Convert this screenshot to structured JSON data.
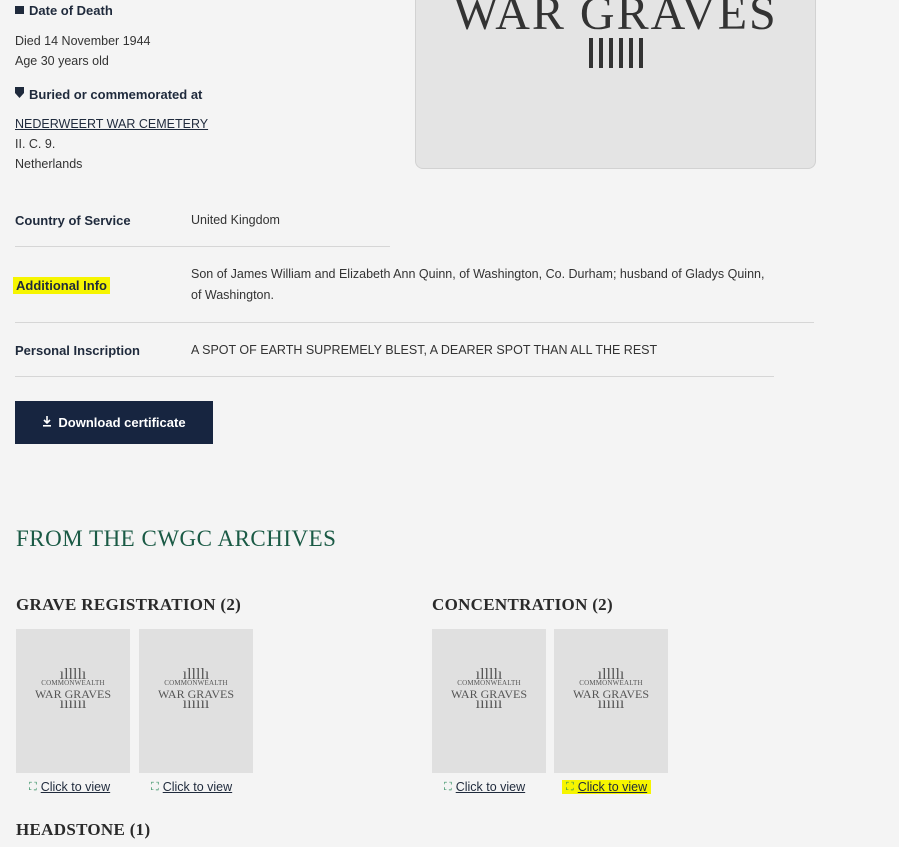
{
  "panel": {
    "title": "WAR GRAVES"
  },
  "death": {
    "heading": "Date of Death",
    "line1": "Died 14 November 1944",
    "line2": "Age 30 years old"
  },
  "burial": {
    "heading": "Buried or commemorated at",
    "cemetery": "NEDERWEERT WAR CEMETERY",
    "plot": "II. C. 9.",
    "country": "Netherlands"
  },
  "details": {
    "country_label": "Country of Service",
    "country_value": "United Kingdom",
    "info_label": "Additional Info",
    "info_line1": "Son of James William and Elizabeth Ann Quinn, of Washington, Co. Durham; husband of Gladys Quinn,",
    "info_line2": "of Washington.",
    "inscription_label": "Personal Inscription",
    "inscription_value": "A SPOT OF EARTH SUPREMELY BLEST, A DEARER SPOT THAN ALL THE REST"
  },
  "download": {
    "label": "Download certificate"
  },
  "archives": {
    "title": "FROM THE CWGC ARCHIVES",
    "grave_title": "GRAVE REGISTRATION (2)",
    "concentration_title": "CONCENTRATION (2)",
    "headstone_title": "HEADSTONE (1)",
    "view_label": "Click to view",
    "logo_top": "COMMONWEALTH",
    "logo_bottom": "WAR GRAVES"
  },
  "colors": {
    "highlight": "#f6f500",
    "button": "#172540",
    "heading_green": "#1a5a45"
  }
}
